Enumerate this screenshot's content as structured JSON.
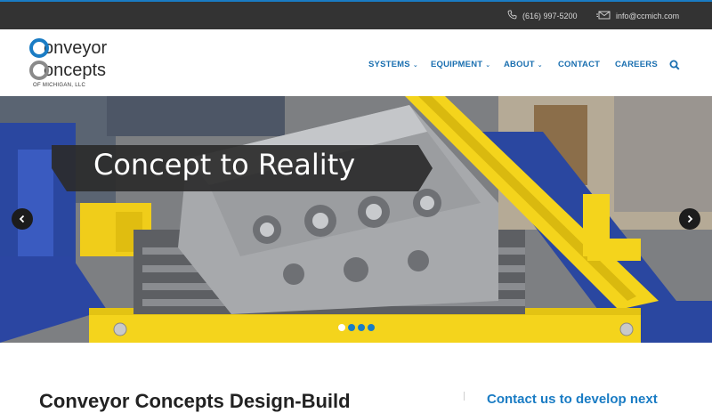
{
  "topbar": {
    "phone": "(616) 997-5200",
    "email": "info@ccmich.com",
    "phone_icon": "phone-icon",
    "email_icon": "envelope-icon"
  },
  "logo": {
    "line1": "onveyor",
    "line2": "oncepts",
    "sub": "OF MICHIGAN, LLC"
  },
  "nav": {
    "items": [
      {
        "label": "SYSTEMS",
        "dropdown": true
      },
      {
        "label": "EQUIPMENT",
        "dropdown": true
      },
      {
        "label": "ABOUT",
        "dropdown": true
      },
      {
        "label": "CONTACT",
        "dropdown": false
      },
      {
        "label": "CAREERS",
        "dropdown": false
      }
    ],
    "search_icon": "search-icon",
    "chevron": "⌄"
  },
  "hero": {
    "caption": "Concept to Reality",
    "prev_icon": "chevron-left-icon",
    "next_icon": "chevron-right-icon",
    "slide_count": 4,
    "active_slide": 1
  },
  "content": {
    "heading": "Conveyor Concepts Design-Build",
    "side_heading": "Contact us to develop next"
  },
  "colors": {
    "accent": "#1a7cc4",
    "topbar": "#333333",
    "banner": "#2b2b2b",
    "frame_yellow": "#f2d11a"
  }
}
